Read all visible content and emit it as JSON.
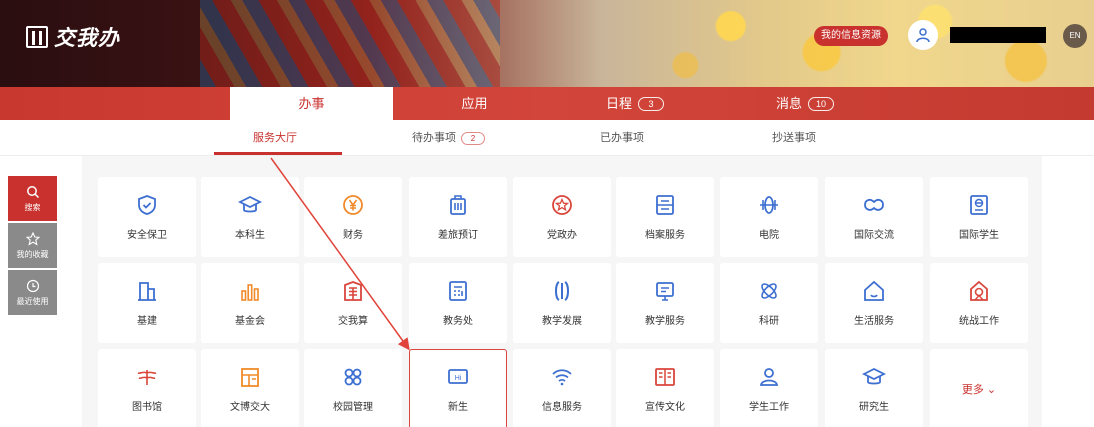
{
  "app": {
    "logo_text": "交我办"
  },
  "header": {
    "info_resources": "我的信息资源",
    "lang": "EN"
  },
  "nav": {
    "tabs": [
      {
        "label": "办事",
        "count": null,
        "active": true
      },
      {
        "label": "应用",
        "count": null,
        "active": false
      },
      {
        "label": "日程",
        "count": "3",
        "active": false
      },
      {
        "label": "消息",
        "count": "10",
        "active": false
      }
    ]
  },
  "subnav": {
    "tabs": [
      {
        "label": "服务大厅",
        "count": null,
        "active": true
      },
      {
        "label": "待办事项",
        "count": "2",
        "active": false
      },
      {
        "label": "已办事项",
        "count": null,
        "active": false
      },
      {
        "label": "抄送事项",
        "count": null,
        "active": false
      }
    ]
  },
  "rail": [
    {
      "label": "搜索",
      "icon": "search-icon"
    },
    {
      "label": "我的收藏",
      "icon": "star-icon"
    },
    {
      "label": "最近使用",
      "icon": "recent-icon"
    }
  ],
  "tiles": [
    {
      "label": "安全保卫",
      "icon": "shield-icon",
      "color": "#3d6fd1"
    },
    {
      "label": "本科生",
      "icon": "graduation-cap-icon",
      "color": "#3d6fd1"
    },
    {
      "label": "财务",
      "icon": "yen-icon",
      "color": "#f08a2a"
    },
    {
      "label": "差旅预订",
      "icon": "suitcase-icon",
      "color": "#3d6fd1"
    },
    {
      "label": "党政办",
      "icon": "party-star-icon",
      "color": "#d9463c"
    },
    {
      "label": "档案服务",
      "icon": "archive-icon",
      "color": "#3d6fd1"
    },
    {
      "label": "电院",
      "icon": "chip-icon",
      "color": "#3d6fd1"
    },
    {
      "label": "国际交流",
      "icon": "handshake-icon",
      "color": "#3d6fd1"
    },
    {
      "label": "国际学生",
      "icon": "passport-icon",
      "color": "#3d6fd1"
    },
    {
      "label": "基建",
      "icon": "building-icon",
      "color": "#3d6fd1"
    },
    {
      "label": "基金会",
      "icon": "bar-chart-icon",
      "color": "#f08a2a"
    },
    {
      "label": "交我算",
      "icon": "compute-icon",
      "color": "#d9463c"
    },
    {
      "label": "教务处",
      "icon": "calculator-icon",
      "color": "#3d6fd1"
    },
    {
      "label": "教学发展",
      "icon": "pillar-icon",
      "color": "#3d6fd1"
    },
    {
      "label": "教学服务",
      "icon": "board-icon",
      "color": "#3d6fd1"
    },
    {
      "label": "科研",
      "icon": "atom-icon",
      "color": "#3d6fd1"
    },
    {
      "label": "生活服务",
      "icon": "home-icon",
      "color": "#3d6fd1"
    },
    {
      "label": "统战工作",
      "icon": "united-icon",
      "color": "#d9463c"
    },
    {
      "label": "图书馆",
      "icon": "library-icon",
      "color": "#d9463c"
    },
    {
      "label": "文博交大",
      "icon": "museum-icon",
      "color": "#f08a2a"
    },
    {
      "label": "校园管理",
      "icon": "grid-icon",
      "color": "#3d6fd1"
    },
    {
      "label": "新生",
      "icon": "hi-icon",
      "color": "#3d6fd1"
    },
    {
      "label": "信息服务",
      "icon": "wifi-icon",
      "color": "#3d6fd1"
    },
    {
      "label": "宣传文化",
      "icon": "book-icon",
      "color": "#d9463c"
    },
    {
      "label": "学生工作",
      "icon": "user-icon",
      "color": "#3d6fd1"
    },
    {
      "label": "研究生",
      "icon": "graduation-cap-icon",
      "color": "#3d6fd1"
    }
  ],
  "more_label": "更多",
  "colors": {
    "brand_red": "#c8312e",
    "blue": "#3d6fd1",
    "orange": "#f08a2a"
  }
}
